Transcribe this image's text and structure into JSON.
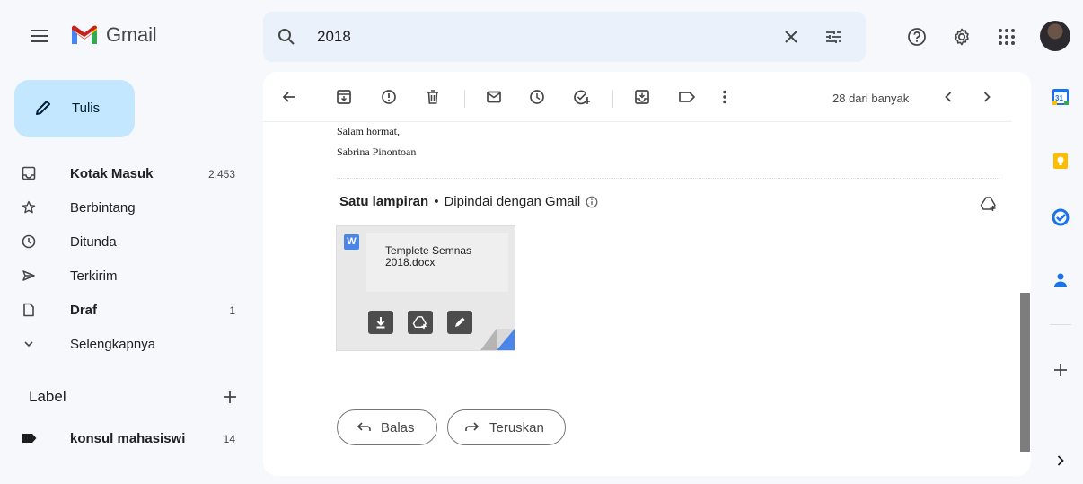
{
  "app": {
    "logo_text": "Gmail"
  },
  "search": {
    "query": "2018"
  },
  "compose": {
    "label": "Tulis"
  },
  "sidebar": {
    "items": [
      {
        "label": "Kotak Masuk",
        "count": "2.453",
        "bold": true
      },
      {
        "label": "Berbintang",
        "count": ""
      },
      {
        "label": "Ditunda",
        "count": ""
      },
      {
        "label": "Terkirim",
        "count": ""
      },
      {
        "label": "Draf",
        "count": "1",
        "bold": true
      },
      {
        "label": "Selengkapnya",
        "count": ""
      }
    ],
    "labels_heading": "Label",
    "labels": [
      {
        "label": "konsul mahasiswi",
        "count": "14"
      }
    ]
  },
  "toolbar": {
    "pager_text": "28 dari banyak"
  },
  "message": {
    "signature": [
      "Salam hormat,",
      "Sabrina Pinontoan"
    ],
    "attachment_heading": "Satu lampiran",
    "attachment_sep": "•",
    "scan_text": "Dipindai dengan Gmail",
    "attachment": {
      "badge": "W",
      "filename": "Templete Semnas 2018.docx"
    },
    "reply_label": "Balas",
    "forward_label": "Teruskan"
  },
  "right_panel": {
    "calendar_day": "31"
  },
  "colors": {
    "compose_bg": "#c2e7ff",
    "search_bg": "#eaf1fb",
    "page_bg": "#f6f8fc",
    "word_blue": "#4a86e8"
  },
  "icons": [
    "menu-icon",
    "gmail-logo-icon",
    "search-icon",
    "clear-icon",
    "filter-icon",
    "help-icon",
    "gear-icon",
    "apps-icon"
  ]
}
